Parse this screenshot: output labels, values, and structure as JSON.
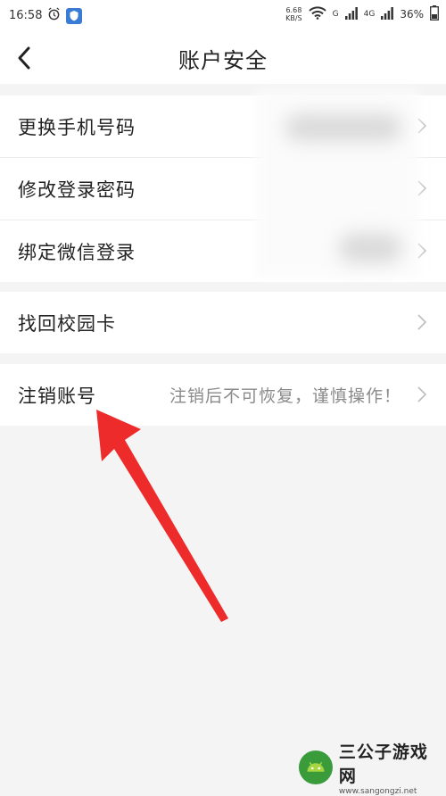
{
  "status_bar": {
    "time": "16:58",
    "net_speed_value": "6.68",
    "net_speed_unit": "KB/S",
    "signal_1": "G",
    "signal_2": "4G",
    "battery": "36%"
  },
  "header": {
    "title": "账户安全"
  },
  "groups": [
    {
      "items": [
        {
          "label": "更换手机号码",
          "hint": ""
        },
        {
          "label": "修改登录密码",
          "hint": ""
        },
        {
          "label": "绑定微信登录",
          "hint": ""
        }
      ]
    },
    {
      "items": [
        {
          "label": "找回校园卡",
          "hint": ""
        }
      ]
    },
    {
      "items": [
        {
          "label": "注销账号",
          "hint": "注销后不可恢复，谨慎操作！"
        }
      ]
    }
  ],
  "watermark": {
    "name": "三公子游戏网",
    "url": "www.sangongzi.net"
  },
  "colors": {
    "background": "#f4f4f4",
    "annotation_arrow": "#ee2b2b",
    "hint_text": "#8a8a8a"
  }
}
